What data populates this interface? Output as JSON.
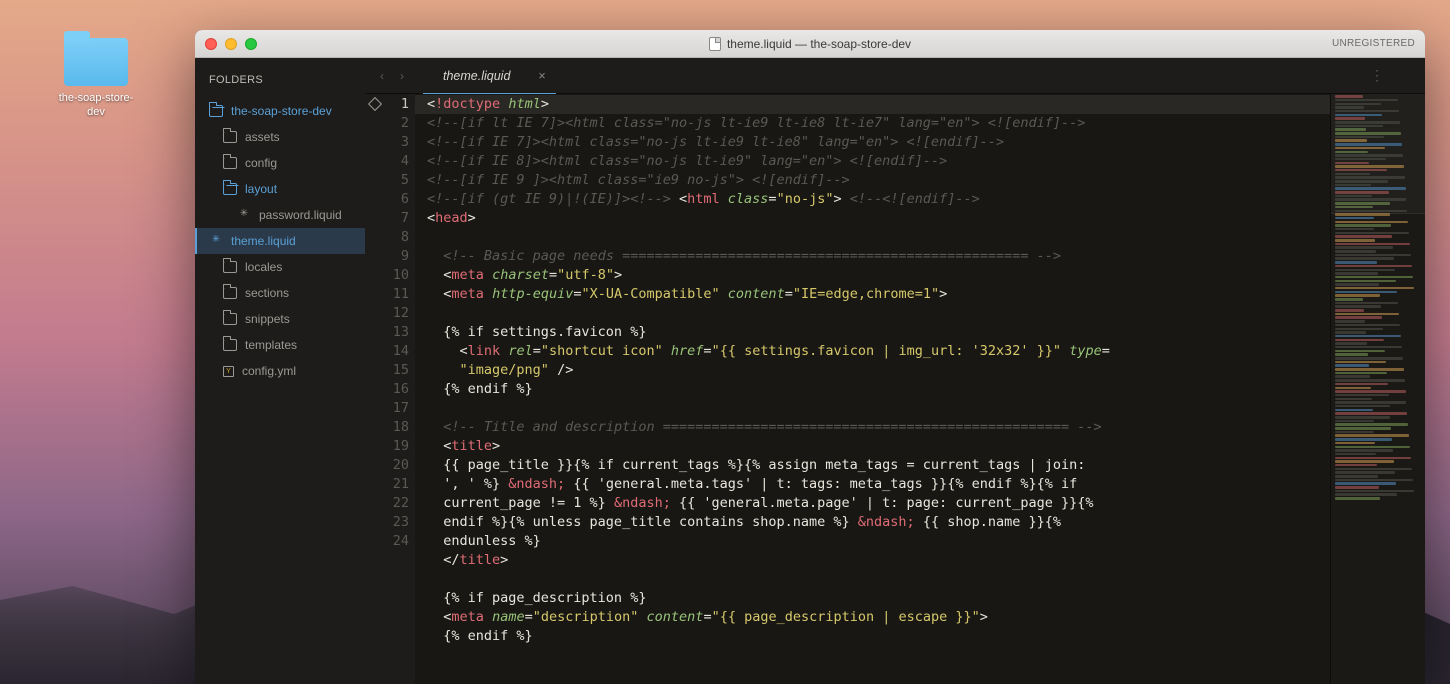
{
  "desktop": {
    "folder_label": "the-soap-store-dev"
  },
  "window": {
    "title": "theme.liquid — the-soap-store-dev",
    "registration": "UNREGISTERED"
  },
  "sidebar": {
    "title": "FOLDERS",
    "root": "the-soap-store-dev",
    "items": [
      {
        "kind": "folder",
        "label": "assets"
      },
      {
        "kind": "folder",
        "label": "config"
      },
      {
        "kind": "folder-open",
        "label": "layout"
      },
      {
        "kind": "file-star",
        "label": "password.liquid"
      },
      {
        "kind": "file-star",
        "label": "theme.liquid",
        "active": true
      },
      {
        "kind": "folder",
        "label": "locales"
      },
      {
        "kind": "folder",
        "label": "sections"
      },
      {
        "kind": "folder",
        "label": "snippets"
      },
      {
        "kind": "folder",
        "label": "templates"
      },
      {
        "kind": "yml",
        "label": "config.yml"
      }
    ]
  },
  "tab": {
    "label": "theme.liquid"
  },
  "code": {
    "line_numbers": [
      "1",
      "2",
      "3",
      "4",
      "5",
      "6",
      "7",
      "8",
      "9",
      "10",
      "11",
      "12",
      "13",
      "14",
      " ",
      "15",
      "16",
      "17",
      "18",
      "19",
      " ",
      " ",
      " ",
      " ",
      "20",
      "21",
      "22",
      "23",
      "24"
    ],
    "lines": [
      {
        "n": "1",
        "hl": true,
        "html": "<span class='c-punct'>&lt;</span><span class='c-tag'>!doctype</span> <span class='c-attr'>html</span><span class='c-punct'>&gt;</span>"
      },
      {
        "n": "2",
        "html": "<span class='c-comment'>&lt;!--[if lt IE 7]&gt;&lt;html class=\"no-js lt-ie9 lt-ie8 lt-ie7\" lang=\"en\"&gt; &lt;![endif]--&gt;</span>"
      },
      {
        "n": "3",
        "html": "<span class='c-comment'>&lt;!--[if IE 7]&gt;&lt;html class=\"no-js lt-ie9 lt-ie8\" lang=\"en\"&gt; &lt;![endif]--&gt;</span>"
      },
      {
        "n": "4",
        "html": "<span class='c-comment'>&lt;!--[if IE 8]&gt;&lt;html class=\"no-js lt-ie9\" lang=\"en\"&gt; &lt;![endif]--&gt;</span>"
      },
      {
        "n": "5",
        "html": "<span class='c-comment'>&lt;!--[if IE 9 ]&gt;&lt;html class=\"ie9 no-js\"&gt; &lt;![endif]--&gt;</span>"
      },
      {
        "n": "6",
        "html": "<span class='c-comment'>&lt;!--[if (gt IE 9)|!(IE)]&gt;&lt;!--&gt;</span> <span class='c-punct'>&lt;</span><span class='c-tag'>html</span> <span class='c-attr'>class</span><span class='c-punct'>=</span><span class='c-str'>\"no-js\"</span><span class='c-punct'>&gt;</span> <span class='c-comment'>&lt;!--&lt;![endif]--&gt;</span>"
      },
      {
        "n": "7",
        "html": "<span class='c-punct'>&lt;</span><span class='c-tag'>head</span><span class='c-punct'>&gt;</span>"
      },
      {
        "n": "8",
        "html": ""
      },
      {
        "n": "9",
        "html": "  <span class='c-comment'>&lt;!-- Basic page needs ================================================== --&gt;</span>"
      },
      {
        "n": "10",
        "html": "  <span class='c-punct'>&lt;</span><span class='c-tag'>meta</span> <span class='c-attr'>charset</span><span class='c-punct'>=</span><span class='c-str'>\"utf-8\"</span><span class='c-punct'>&gt;</span>"
      },
      {
        "n": "11",
        "html": "  <span class='c-punct'>&lt;</span><span class='c-tag'>meta</span> <span class='c-attr'>http-equiv</span><span class='c-punct'>=</span><span class='c-str'>\"X-UA-Compatible\"</span> <span class='c-attr'>content</span><span class='c-punct'>=</span><span class='c-str'>\"IE=edge,chrome=1\"</span><span class='c-punct'>&gt;</span>"
      },
      {
        "n": "12",
        "html": ""
      },
      {
        "n": "13",
        "html": "  {% if settings.favicon %}"
      },
      {
        "n": "14",
        "html": "    <span class='c-punct'>&lt;</span><span class='c-tag'>link</span> <span class='c-attr'>rel</span><span class='c-punct'>=</span><span class='c-str'>\"shortcut icon\"</span> <span class='c-attr'>href</span><span class='c-punct'>=</span><span class='c-str'>\"{{ settings.favicon | img_url: '32x32' }}\"</span> <span class='c-attr'>type</span><span class='c-punct'>=</span>"
      },
      {
        "n": "",
        "html": "    <span class='c-str'>\"image/png\"</span> <span class='c-punct'>/&gt;</span>"
      },
      {
        "n": "15",
        "html": "  {% endif %}"
      },
      {
        "n": "16",
        "html": ""
      },
      {
        "n": "17",
        "html": "  <span class='c-comment'>&lt;!-- Title and description ================================================== --&gt;</span>"
      },
      {
        "n": "18",
        "html": "  <span class='c-punct'>&lt;</span><span class='c-tag'>title</span><span class='c-punct'>&gt;</span>"
      },
      {
        "n": "19",
        "html": "  {{ page_title }}{% if current_tags %}{% assign meta_tags = current_tags | join:"
      },
      {
        "n": "",
        "html": "  ', ' %} <span class='c-ndash'>&amp;ndash;</span> {{ 'general.meta.tags' | t: tags: meta_tags }}{% endif %}{% if"
      },
      {
        "n": "",
        "html": "  current_page != 1 %} <span class='c-ndash'>&amp;ndash;</span> {{ 'general.meta.page' | t: page: current_page }}{%"
      },
      {
        "n": "",
        "html": "  endif %}{% unless page_title contains shop.name %} <span class='c-ndash'>&amp;ndash;</span> {{ shop.name }}{%"
      },
      {
        "n": "",
        "html": "  endunless %}"
      },
      {
        "n": "20",
        "html": "  <span class='c-punct'>&lt;/</span><span class='c-tag'>title</span><span class='c-punct'>&gt;</span>"
      },
      {
        "n": "21",
        "html": ""
      },
      {
        "n": "22",
        "html": "  {% if page_description %}"
      },
      {
        "n": "23",
        "html": "  <span class='c-punct'>&lt;</span><span class='c-tag'>meta</span> <span class='c-attr'>name</span><span class='c-punct'>=</span><span class='c-str'>\"description\"</span> <span class='c-attr'>content</span><span class='c-punct'>=</span><span class='c-str'>\"{{ page_description | escape }}\"</span><span class='c-punct'>&gt;</span>"
      },
      {
        "n": "24",
        "html": "  {% endif %}"
      }
    ]
  }
}
